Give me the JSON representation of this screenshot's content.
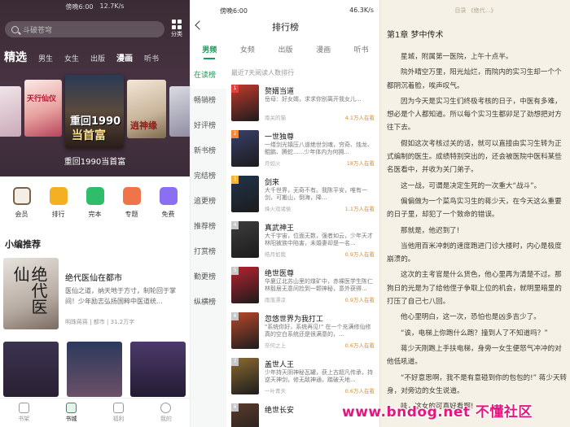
{
  "left": {
    "status_time": "傍晚6:00",
    "status_info": "12.7K/s",
    "search_placeholder": "斗破苍穹",
    "category_label": "分类",
    "channels": [
      "精选",
      "男生",
      "女生",
      "出版",
      "漫画",
      "听书"
    ],
    "hero_cover_title": "重回1990当首富",
    "cover_art_titles": [
      "重回1990",
      "当首富"
    ],
    "cover_small_1": "天行仙仪",
    "cover_small_2": "逍神缘",
    "quick_entries": [
      {
        "label": "会员",
        "color": "#7a6448"
      },
      {
        "label": "排行",
        "color": "#f2b022"
      },
      {
        "label": "完本",
        "color": "#2fbd6c"
      },
      {
        "label": "专题",
        "color": "#f0744a"
      },
      {
        "label": "免费",
        "color": "#8a6ff2"
      }
    ],
    "section_title": "小编推荐",
    "recommend": {
      "cover_text": "绝代医仙",
      "title": "绝代医仙在都市",
      "desc": "医仙之道，纳天地于方寸，制轮回于掌间！少年励志弘扬国粹中医道统...",
      "meta": "明珠蒋蒋 | 都市 | 31.2万字"
    },
    "tabbar": [
      "书架",
      "书城",
      "福利",
      "我的"
    ]
  },
  "middle": {
    "status_time": "傍晚6:00",
    "status_right": "46.3K/s",
    "title": "排行榜",
    "tabs": [
      "男频",
      "女频",
      "出版",
      "漫画",
      "听书"
    ],
    "side_menu": [
      "在读榜",
      "畅销榜",
      "好评榜",
      "新书榜",
      "完结榜",
      "追更榜",
      "推荐榜",
      "打赏榜",
      "勤更榜",
      "纵横榜"
    ],
    "list_heading": "最近7天阅读人数排行",
    "books": [
      {
        "name": "赘婿当道",
        "desc": "岳母：好女婿，求求你别离开我女儿...",
        "author": "南关的猫",
        "readers": "4.1万人在看",
        "color": "#c2392c"
      },
      {
        "name": "一世独尊",
        "desc": "一缕剑光镇压八道绝世剑魂，穷奇、烛龙、鲲鹏、腾蛇......少年体内为何拥...",
        "author": "月如火",
        "readers": "18万人在看",
        "color": "#3a3f6a"
      },
      {
        "name": "剑来",
        "desc": "大千世界，无奇不有。我陈平安，唯有一剑，可搬山，倒海，降...",
        "author": "烽火戏诸侯",
        "readers": "1.1万人在看",
        "color": "#20344a"
      },
      {
        "name": "真武神王",
        "desc": "大千宇宙，位面无数，强者如云，少年天才林阳被族中陷害，未婚妻却是一名...",
        "author": "皓月如我",
        "readers": "0.9万人在看",
        "color": "#3d3d3d"
      },
      {
        "name": "绝世医尊",
        "desc": "华夏辽北苏山里的煤矿中，赤裸医学生陈仁林毅居无意间捡到一颗神秘，意外获得...",
        "author": "雨落漂凉",
        "readers": "0.9万人在看",
        "color": "#b8222f"
      },
      {
        "name": "忽悠世界为我打工",
        "desc": "\"系统你好，系统再见!\" 在一个充满修仙修真的空白系统还是很满意的，...",
        "author": "奈何之上",
        "readers": "0.6万人在看",
        "color": "#b8482a"
      },
      {
        "name": "盖世人王",
        "desc": "少年持天阴神秘瓦罐，获上古超凡传承，持逆天神剑，修无敌神通，踏破天地...",
        "author": "一叶青天",
        "readers": "0.6万人在看",
        "color": "#8c6a30"
      },
      {
        "name": "绝世长安",
        "desc": "",
        "author": "",
        "readers": "",
        "color": "#5c3b2c"
      }
    ]
  },
  "right": {
    "breadcrumb": "目录  《绝代...》",
    "chapter_title": "第1章  梦中传术",
    "paragraphs": [
      "星城，附属第一医院，上午十点半。",
      "院外晴空万里，阳光灿烂，而院内的实习生却一个个都阴沉着脸，唉声叹气。",
      "因为今天是实习生们终极考核的日子，中医有多难，想必是个人都知道。所以每个实习生都卯足了劲想把对方往下去。",
      "假如这次考核过关的话，就可以直接由实习生转为正式编制的医生。成绩特别突出的，还会被医院中医科某些名医看中，并收为关门弟子。",
      "这一战，可谓是决定生死的一次重大“战斗”。",
      "偏偏做为一个菜鸟实习生的蒋少天，在今天这么重要的日子里，却犯了一个致命的错误。",
      "那就是，他迟到了!",
      "当他用百米冲刺的速度跑进门诊大楼时，内心是极度崩溃的。",
      "这次的主考官是什么货色，他心里再为清楚不过。那狗日的光是为了给他侄子争取上位的机会，就明里暗里的打压了自己七八回。",
      "他心里明白，这一次，恐怕也是凶多吉少了。",
      "“诶，电梯上你跑什么跑？撞到人了不知道吗？”",
      "蒋少天刚跑上手扶电梯，身旁一女生便怒气冲冲的对他低吼道。",
      "“不好意思啊，我不是有意碰到你的包包的!” 蒋少天转身，对旁边的女生说道。",
      "哇，这女的可真好看啊!"
    ]
  },
  "watermark": "www.bndog.net 不懂社区"
}
